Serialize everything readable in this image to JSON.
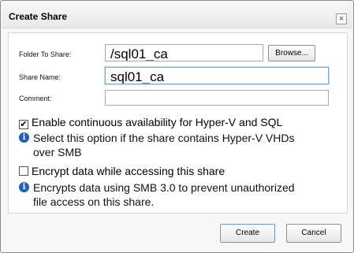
{
  "dialog": {
    "title": "Create Share",
    "close_glyph": "×"
  },
  "form": {
    "folder_label": "Folder To Share:",
    "folder_value": "/sql01_ca",
    "browse_label": "Browse...",
    "share_name_label": "Share Name:",
    "share_name_value": "sql01_ca",
    "comment_label": "Comment:",
    "comment_value": ""
  },
  "options": {
    "continuous_availability": {
      "label": "Enable continuous availability for Hyper-V and SQL",
      "checked": true,
      "check_glyph": "✔",
      "info_line1": "Select this option if the share contains Hyper-V VHDs",
      "info_line2": "over SMB"
    },
    "encrypt": {
      "label": "Encrypt data while accessing this share",
      "checked": false,
      "info_line1": "Encrypts data using SMB 3.0 to prevent unauthorized",
      "info_line2": "file access on this share."
    },
    "info_icon_glyph": "i"
  },
  "footer": {
    "create_label": "Create",
    "cancel_label": "Cancel"
  },
  "colors": {
    "info_icon": "#1f5fb8",
    "focus_border": "#7aa7d4"
  },
  "icons": {
    "close": "close-icon",
    "info": "info-icon",
    "checkbox_checked": "checkmark-icon"
  }
}
